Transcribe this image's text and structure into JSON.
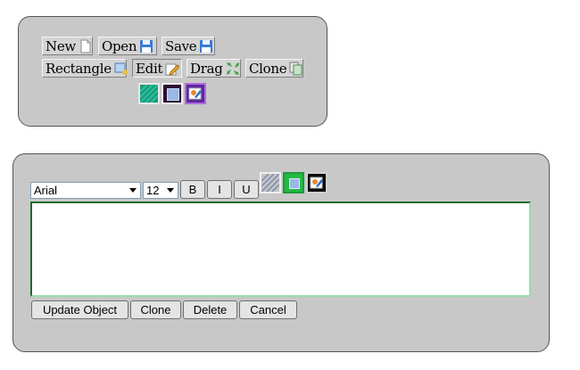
{
  "toolbar": {
    "new_label": "New",
    "open_label": "Open",
    "save_label": "Save",
    "rectangle_label": "Rectangle",
    "edit_label": "Edit",
    "drag_label": "Drag",
    "clone_label": "Clone",
    "icons": [
      "document-icon",
      "floppy-disk-icon",
      "floppy-disk-icon",
      "rectangle-tool-icon",
      "edit-pencil-icon",
      "drag-arrows-icon",
      "clone-icon"
    ],
    "swatches": [
      {
        "name": "fill-swatch",
        "color": "#1a9a7a"
      },
      {
        "name": "stroke-swatch",
        "color": "#2a0f30"
      },
      {
        "name": "picture-swatch",
        "color": "#5a2a9a"
      }
    ]
  },
  "editor": {
    "font_family": "Arial",
    "font_size": "12",
    "bold_label": "B",
    "italic_label": "I",
    "underline_label": "U",
    "text_value": "",
    "update_label": "Update Object",
    "clone_label": "Clone",
    "delete_label": "Delete",
    "cancel_label": "Cancel",
    "swatches": [
      {
        "name": "fill-swatch",
        "color": "#c4c4c4"
      },
      {
        "name": "stroke-swatch",
        "color": "#22bb44"
      },
      {
        "name": "picture-swatch",
        "color": "#0a0a0a"
      }
    ]
  }
}
